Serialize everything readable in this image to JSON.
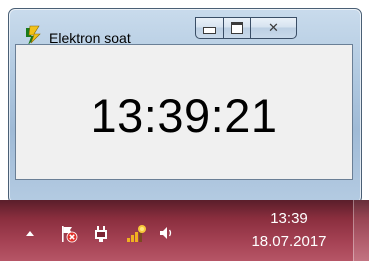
{
  "window": {
    "title": "Elektron soat",
    "app_icon": "yellow-lightning-app-icon",
    "controls": {
      "minimize_icon": "minimize-icon",
      "maximize_icon": "maximize-icon",
      "close_icon": "close-icon"
    }
  },
  "clock_display": {
    "time": "13:39:21"
  },
  "taskbar": {
    "tray_icons": [
      "show-hidden-icons-arrow",
      "action-center-flag-icon",
      "power-icon",
      "network-icon",
      "volume-icon"
    ],
    "time": "13:39",
    "date": "18.07.2017"
  },
  "colors": {
    "taskbar": "#8a2e3e",
    "window_glass": "#aec7df",
    "client_bg": "#f0f0f0"
  }
}
